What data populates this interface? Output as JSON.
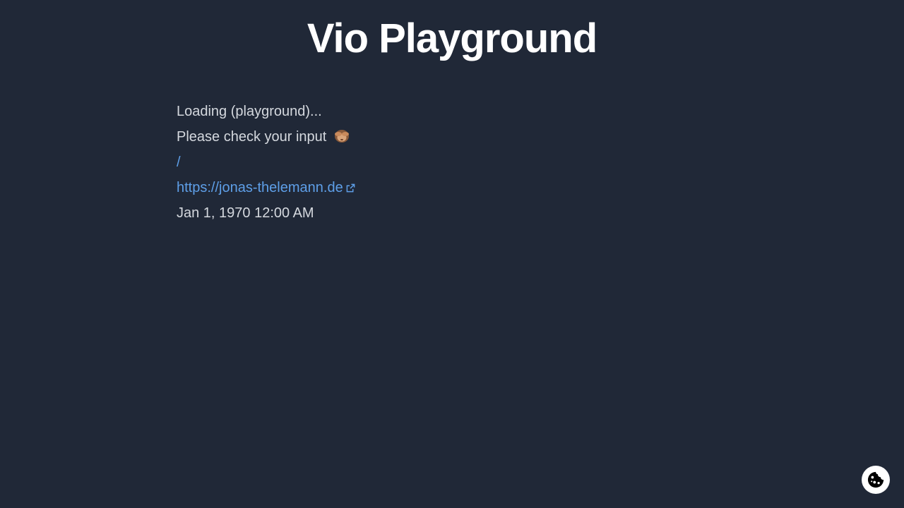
{
  "header": {
    "title": "Vio Playground"
  },
  "main": {
    "loading_text": "Loading (playground)...",
    "input_message": "Please check your input",
    "input_emoji_icon": "see-no-evil-monkey-icon",
    "root_link": "/",
    "author_link": "https://jonas-thelemann.de",
    "external_link_icon": "external-link-icon",
    "timestamp": "Jan 1, 1970 12:00 AM"
  },
  "cookie_button": {
    "icon": "cookie-icon"
  },
  "colors": {
    "background": "#202837",
    "link": "#5e9fe8",
    "text": "#d4d8de",
    "title": "#ffffff"
  }
}
